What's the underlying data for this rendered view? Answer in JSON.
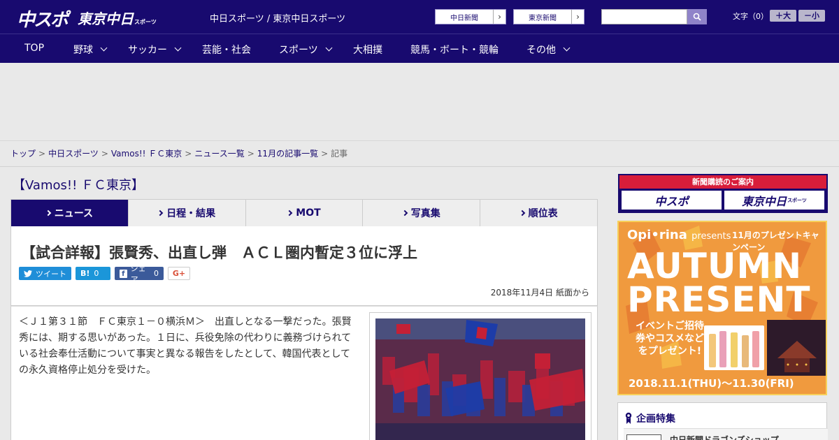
{
  "header": {
    "logo_main": "中スポ",
    "logo_tokyo": "東京中日",
    "logo_tokyo_sub": "スポーツ",
    "site_title": "中日スポーツ / 東京中日スポーツ",
    "paper_links": [
      "中日新聞",
      "東京新聞"
    ],
    "search_placeholder": "",
    "font_size_label": "文字（0）",
    "font_larger": "＋大",
    "font_smaller": "－小"
  },
  "nav": {
    "items": [
      {
        "label": "TOP",
        "has_menu": false
      },
      {
        "label": "野球",
        "has_menu": true
      },
      {
        "label": "サッカー",
        "has_menu": true
      },
      {
        "label": "芸能・社会",
        "has_menu": false
      },
      {
        "label": "スポーツ",
        "has_menu": true
      },
      {
        "label": "大相撲",
        "has_menu": false
      },
      {
        "label": "競馬・ボート・競輪",
        "has_menu": false
      },
      {
        "label": "その他",
        "has_menu": true
      }
    ]
  },
  "breadcrumb": {
    "items": [
      "トップ",
      "中日スポーツ",
      "Vamos!! ＦＣ東京",
      "ニュース一覧",
      "11月の記事一覧"
    ],
    "current": "記事",
    "separator": ">"
  },
  "section": {
    "title": "【Vamos!! ＦＣ東京】"
  },
  "tabs": [
    {
      "label": "ニュース",
      "active": true
    },
    {
      "label": "日程・結果",
      "active": false
    },
    {
      "label": "MOT",
      "active": false
    },
    {
      "label": "写真集",
      "active": false
    },
    {
      "label": "順位表",
      "active": false
    }
  ],
  "article": {
    "title": "【試合詳報】張賢秀、出直し弾　ＡＣＬ圏内暫定３位に浮上",
    "share": {
      "tweet": "ツイート",
      "hatena": "B!",
      "hatena_count": "0",
      "facebook": "シェア",
      "facebook_count": "0",
      "gplus": "G+"
    },
    "date": "2018年11月4日 紙面から",
    "body": "＜Ｊ１第３１節　ＦＣ東京１－０横浜Ｍ＞　出直しとなる一撃だった。張賢秀には、期する思いがあった。１日に、兵役免除の代わりに義務づけられている社会奉仕活動について事実と異なる報告をしたとして、韓国代表としての永久資格停止処分を受けた。"
  },
  "sidebar": {
    "subscription": {
      "header": "新聞購読のご案内",
      "logo_left": "中スポ",
      "logo_right": "東京中日",
      "logo_right_sub": "スポーツ"
    },
    "ad": {
      "brand": "Opi•rina",
      "presents": "presents",
      "campaign": "11月のプレゼントキャンペーン",
      "headline1": "AUTUMN",
      "headline2": "PRESENT",
      "promo": "イベントご招待券やコスメなどをプレゼント!",
      "dates": "2018.11.1(THU)〜11.30(FRI)"
    },
    "feature": {
      "title": "企画特集",
      "item": "中日新聞ドラゴンズショップ"
    }
  },
  "colors": {
    "brand_navy": "#180a6f",
    "subscription_red": "#d81d3a",
    "ad_orange": "#f3a14a"
  }
}
